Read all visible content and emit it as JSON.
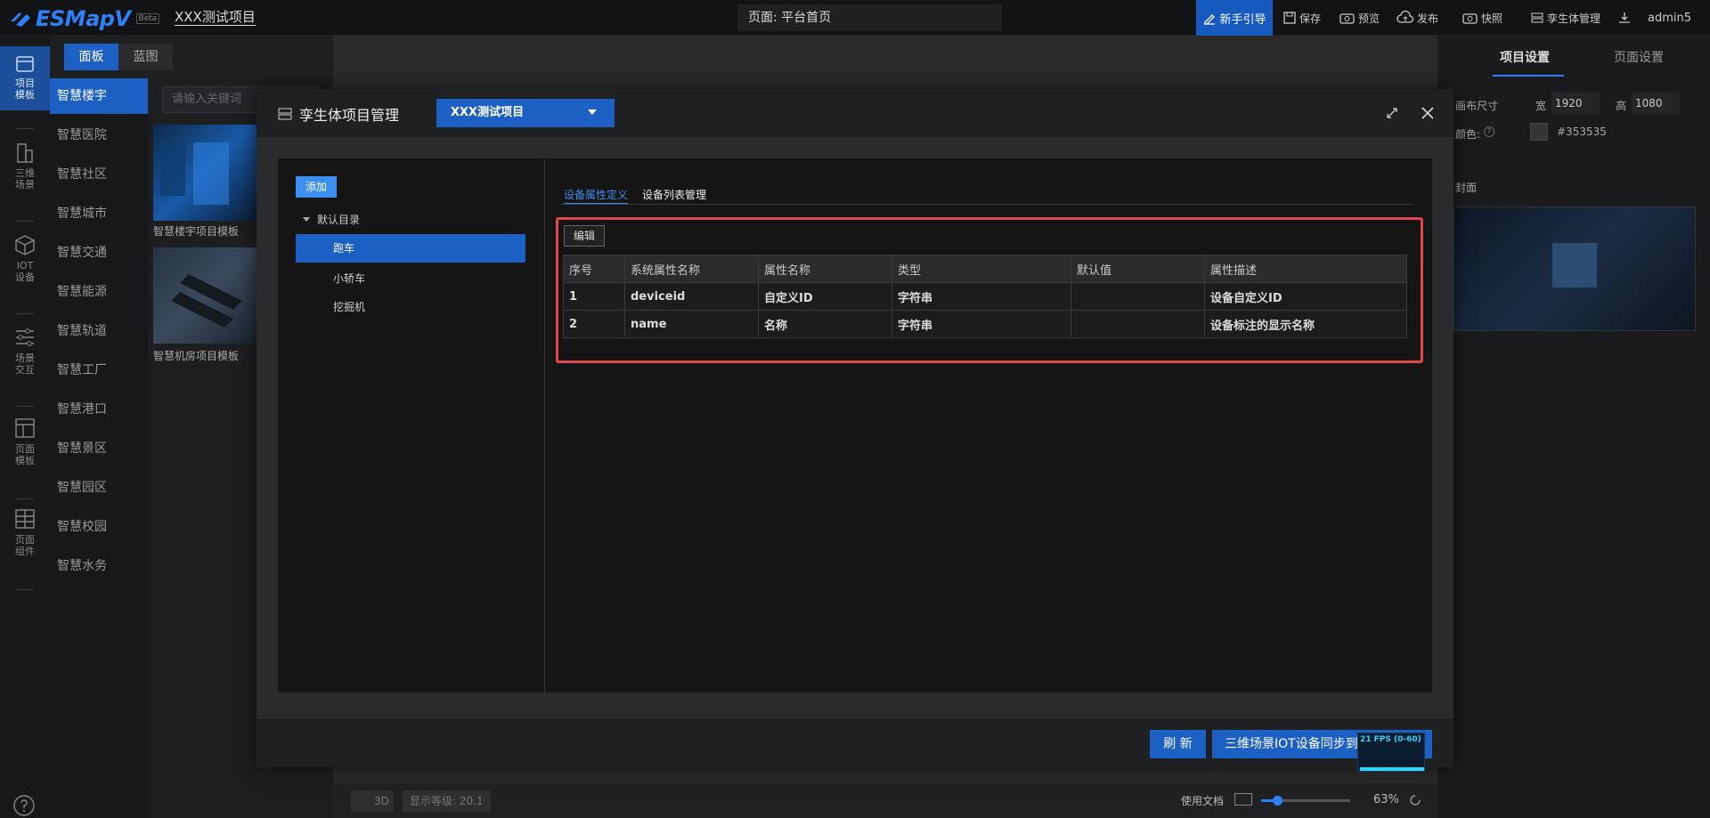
{
  "app": {
    "name": "ESMapV",
    "beta": "Beta",
    "project_title": "XXX测试项目"
  },
  "topbar": {
    "page_label": "页面: 平台首页",
    "guide": "新手引导",
    "save": "保存",
    "preview": "预览",
    "publish": "发布",
    "snapshot": "快照",
    "twin_mgmt": "孪生体管理",
    "user": "admin5"
  },
  "rail": [
    {
      "label": "项目\n模板",
      "icon": "project-template-icon"
    },
    {
      "label": "三维\n场景",
      "icon": "buildings-icon"
    },
    {
      "label": "IOT\n设备",
      "icon": "cube-icon"
    },
    {
      "label": "场景\n交互",
      "icon": "sliders-icon"
    },
    {
      "label": "页面\n模板",
      "icon": "layout-icon"
    },
    {
      "label": "页面\n组件",
      "icon": "grid-icon"
    }
  ],
  "panel_tabs": [
    "面板",
    "蓝图"
  ],
  "categories": [
    "智慧楼宇",
    "智慧医院",
    "智慧社区",
    "智慧城市",
    "智慧交通",
    "智慧能源",
    "智慧轨道",
    "智慧工厂",
    "智慧港口",
    "智慧景区",
    "智慧园区",
    "智慧校园",
    "智慧水务"
  ],
  "search": {
    "placeholder": "请输入关键词"
  },
  "templates": [
    "智慧楼宇项目模板",
    "智慧机房项目模板"
  ],
  "right_panel": {
    "tabs": [
      "项目设置",
      "页面设置"
    ],
    "canvas_size_label": "画布尺寸",
    "width_label": "宽",
    "width_value": "1920",
    "height_label": "高",
    "height_value": "1080",
    "color_label": "颜色:",
    "color_value": "#353535",
    "cover_label": "封面"
  },
  "bottom": {
    "mode": "3D",
    "level": "显示等级: 20.1",
    "docs": "使用文档",
    "zoom": "63%"
  },
  "modal": {
    "title": "孪生体项目管理",
    "project_select": "XXX测试项目",
    "add_button": "添加",
    "tree": {
      "root": "默认目录",
      "items": [
        "跑车",
        "小轿车",
        "挖掘机"
      ],
      "selected": 0
    },
    "tabs": [
      "设备属性定义",
      "设备列表管理"
    ],
    "edit_button": "编辑",
    "columns": [
      "序号",
      "系统属性名称",
      "属性名称",
      "类型",
      "默认值",
      "属性描述"
    ],
    "rows": [
      [
        "1",
        "deviceid",
        "自定义ID",
        "字符串",
        "",
        "设备自定义ID"
      ],
      [
        "2",
        "name",
        "名称",
        "字符串",
        "",
        "设备标注的显示名称"
      ]
    ],
    "refresh_button": "刷 新",
    "sync_button": "三维场景IOT设备同步到",
    "fps": "21 FPS (0-60)"
  },
  "colors": {
    "accent": "#1d60c4",
    "highlight": "#e0484e",
    "active_tab": "#3b8ff0"
  }
}
